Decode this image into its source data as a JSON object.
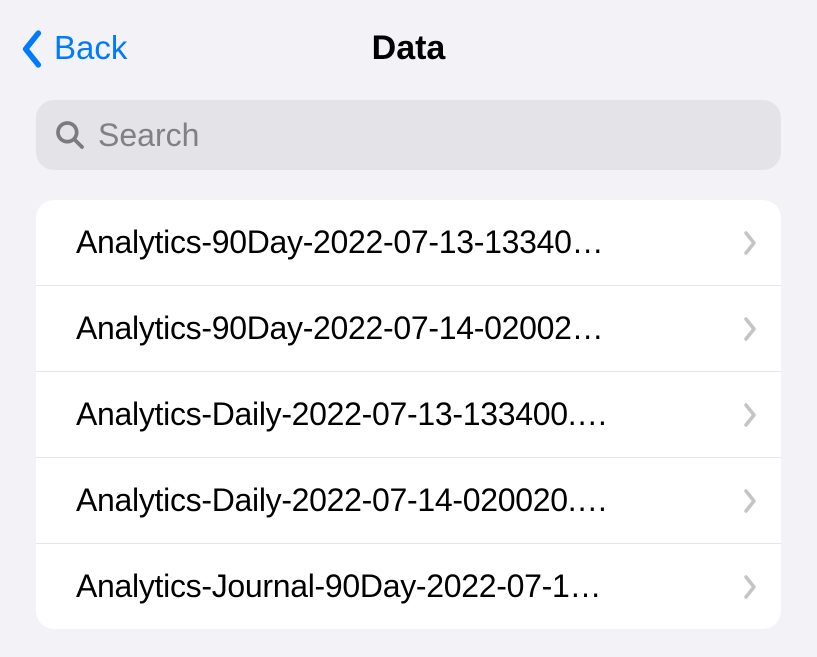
{
  "nav": {
    "back_label": "Back",
    "title": "Data"
  },
  "search": {
    "placeholder": "Search",
    "value": ""
  },
  "list": {
    "items": [
      {
        "label": "Analytics-90Day-2022-07-13-13340…"
      },
      {
        "label": "Analytics-90Day-2022-07-14-02002…"
      },
      {
        "label": "Analytics-Daily-2022-07-13-133400.…"
      },
      {
        "label": "Analytics-Daily-2022-07-14-020020.…"
      },
      {
        "label": "Analytics-Journal-90Day-2022-07-1…"
      }
    ]
  }
}
